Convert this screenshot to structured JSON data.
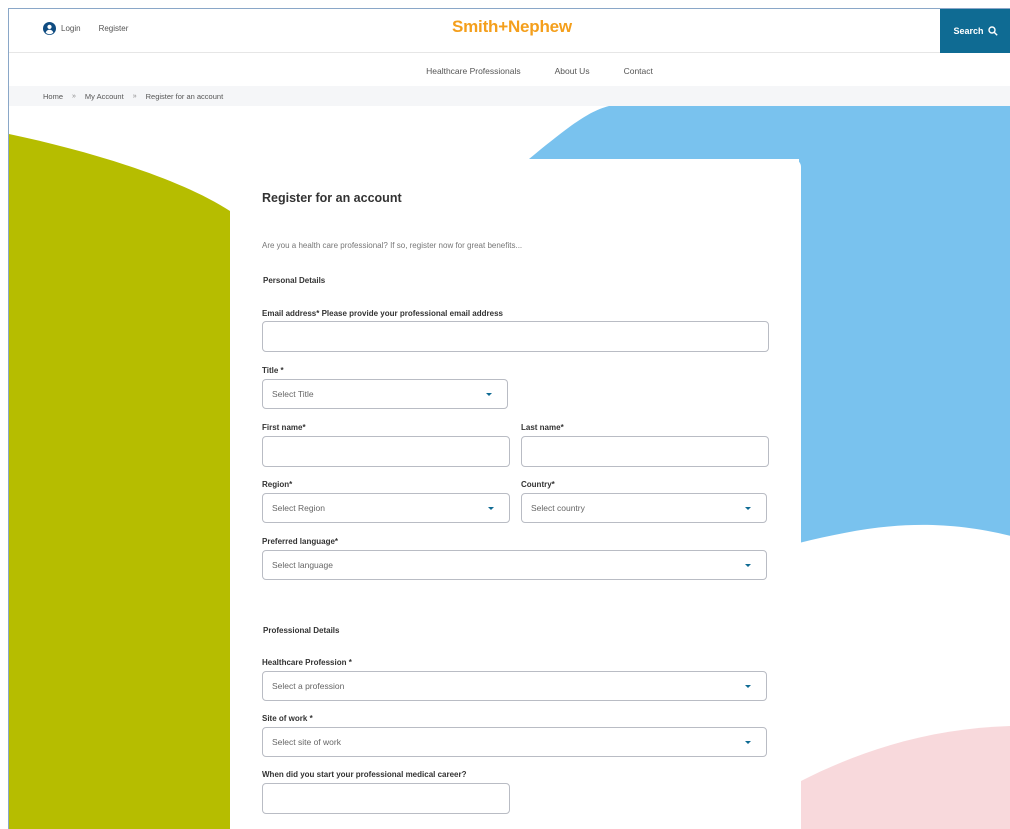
{
  "header": {
    "login_label": "Login",
    "register_label": "Register",
    "logo_left": "Smith",
    "logo_mark": "+",
    "logo_right": "Nephew",
    "search_label": "Search",
    "brand_color": "#f49f1c",
    "accent_color": "#0f6b93"
  },
  "nav": {
    "items": [
      "Healthcare Professionals",
      "About Us",
      "Contact"
    ]
  },
  "breadcrumb": {
    "items": [
      "Home",
      "My Account",
      "Register for an account"
    ],
    "separator": "»"
  },
  "form": {
    "title": "Register for an account",
    "intro": "Are you a health care professional? If so, register now for great benefits...",
    "personal_section": "Personal Details",
    "email_label": "Email address* Please provide your professional email address",
    "title_label": "Title *",
    "title_placeholder": "Select Title",
    "first_name_label": "First name*",
    "last_name_label": "Last name*",
    "region_label": "Region*",
    "region_placeholder": "Select Region",
    "country_label": "Country*",
    "country_placeholder": "Select country",
    "language_label": "Preferred language*",
    "language_placeholder": "Select language",
    "professional_section": "Professional Details",
    "profession_label": "Healthcare Profession *",
    "profession_placeholder": "Select a profession",
    "site_label": "Site of work *",
    "site_placeholder": "Select site of work",
    "career_label": "When did you start your professional medical career?"
  },
  "colors": {
    "deco_green": "#b6bd00",
    "deco_blue": "#79c2ee",
    "deco_pink": "#f8d9dc"
  }
}
